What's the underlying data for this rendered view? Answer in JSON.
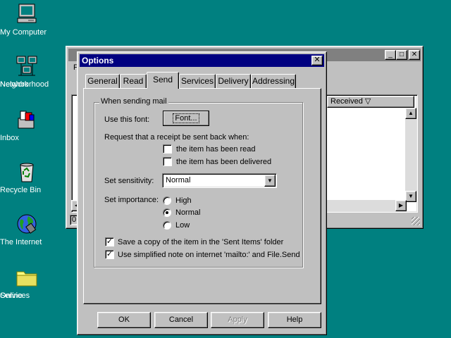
{
  "desktop": {
    "icons": [
      {
        "label": "My Computer",
        "icon": "computer-icon"
      },
      {
        "label": "Network Neighborhood",
        "label_line1": "Network",
        "label_line2": "Neighborhood",
        "icon": "network-icon"
      },
      {
        "label": "Inbox",
        "icon": "inbox-icon"
      },
      {
        "label": "Recycle Bin",
        "icon": "recycle-bin-icon"
      },
      {
        "label": "The Internet",
        "icon": "internet-globe-icon"
      },
      {
        "label": "Online Services",
        "label_line1": "Online",
        "label_line2": "Services",
        "icon": "folder-icon"
      }
    ]
  },
  "background_window": {
    "column_received": "Received",
    "status_text": "0",
    "menu_first_letter": "F"
  },
  "dialog": {
    "title": "Options",
    "close_glyph": "✕",
    "tabs": [
      "General",
      "Read",
      "Send",
      "Services",
      "Delivery",
      "Addressing"
    ],
    "active_tab": "Send",
    "group_title": "When sending mail",
    "font_label": "Use this font:",
    "font_button": "Font...",
    "receipt_label": "Request that a receipt be sent back when:",
    "receipt_read": {
      "label": "the item has been read",
      "checked": false
    },
    "receipt_delivered": {
      "label": "the item has been delivered",
      "checked": false
    },
    "sensitivity_label": "Set sensitivity:",
    "sensitivity_value": "Normal",
    "importance_label": "Set importance:",
    "importance_options": [
      "High",
      "Normal",
      "Low"
    ],
    "importance_selected": "Normal",
    "save_copy": {
      "label": "Save a copy of the item in the 'Sent Items' folder",
      "checked": true
    },
    "simplified_note": {
      "label": "Use simplified note on internet 'mailto:' and File.Send",
      "checked": true
    },
    "buttons": {
      "ok": "OK",
      "cancel": "Cancel",
      "apply": "Apply",
      "help": "Help"
    }
  },
  "colors": {
    "desktop": "#008080",
    "title_active": "#000080",
    "title_inactive": "#808080",
    "face": "#c0c0c0"
  }
}
